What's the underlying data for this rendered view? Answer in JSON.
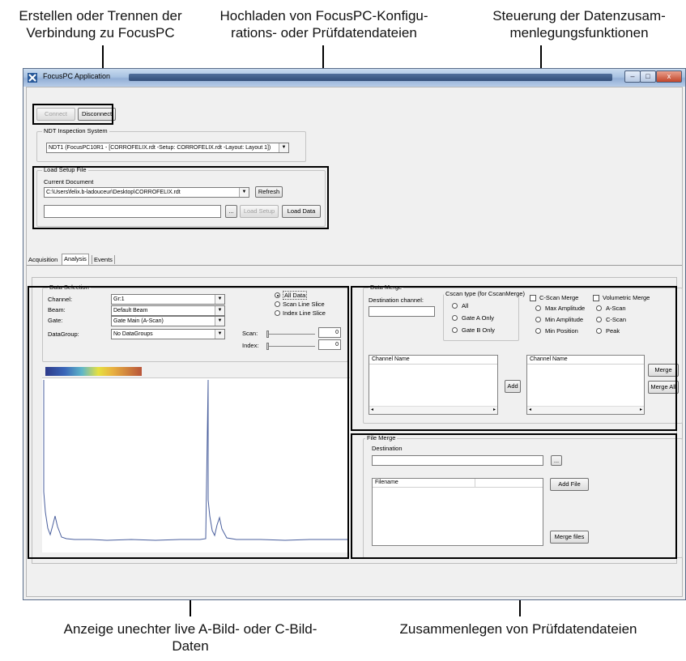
{
  "callouts": {
    "connect": "Erstellen oder Trennen der\nVerbindung zu FocusPC",
    "upload": "Hochladen von FocusPC-Konfigu-\nrations- oder Prüfdatendateien",
    "merge_control": "Steuerung der Datenzusam-\nmenlegungsfunktionen",
    "display": "Anzeige unechter live A-Bild- oder C-Bild-\nDaten",
    "file_merge": "Zusammenlegen von Prüfdatendateien"
  },
  "window": {
    "title": "FocusPC Application",
    "minimize": "–",
    "maximize": "□",
    "close": "x"
  },
  "connection": {
    "connect_label": "Connect",
    "disconnect_label": "Disconnect"
  },
  "ndt": {
    "group_label": "NDT Inspection System",
    "selected": "NDT1 (FocusPC10R1 - [CORROFELIX.rdt -Setup: CORROFELIX.rdt -Layout: Layout 1])"
  },
  "setup": {
    "group_label": "Load Setup File",
    "current_document_label": "Current Document",
    "current_document": "C:\\Users\\felix.b-ladouceur\\Desktop\\CORROFELIX.rdt",
    "refresh_label": "Refresh",
    "path_value": "",
    "browse_label": "...",
    "load_setup_label": "Load Setup",
    "load_data_label": "Load Data"
  },
  "tabs": [
    "Acquisition",
    "Analysis",
    "Events"
  ],
  "active_tab": "Analysis",
  "data_selection": {
    "group_label": "Data Selection",
    "channel_label": "Channel:",
    "channel_value": "Gr:1",
    "beam_label": "Beam:",
    "beam_value": "Default Beam",
    "gate_label": "Gate:",
    "gate_value": "Gate Main (A-Scan)",
    "datagroup_label": "DataGroup:",
    "datagroup_value": "No DataGroups",
    "radio_all": "All Data",
    "radio_scan": "Scan Line Slice",
    "radio_index": "Index Line Slice",
    "selected_radio": "All Data",
    "scan_label": "Scan:",
    "scan_value": "0",
    "index_label": "Index:",
    "index_value": "0"
  },
  "data_merge": {
    "group_label": "Data Merge",
    "destination_label": "Destination channel:",
    "destination_value": "",
    "cscan_group_label": "Cscan type (for CscanMerge)",
    "cscan_options": [
      "All",
      "Gate A Only",
      "Gate B Only"
    ],
    "cscan_merge_label": "C-Scan Merge",
    "cscan_merge_options": [
      "Max Amplitude",
      "Min Amplitude",
      "Min Position"
    ],
    "volumetric_label": "Volumetric Merge",
    "volumetric_options": [
      "A-Scan",
      "C-Scan",
      "Peak"
    ],
    "channel_name_header": "Channel Name",
    "add_label": "Add",
    "merge_label": "Merge",
    "merge_all_label": "Merge All"
  },
  "file_merge": {
    "group_label": "File Merge",
    "destination_label": "Destination",
    "destination_value": "",
    "browse_label": "...",
    "filename_header": "Filename",
    "add_file_label": "Add File",
    "merge_files_label": "Merge files"
  },
  "colors": {
    "title_bar": "#a8c2e2",
    "window_bg": "#f0f0f0",
    "callout_border": "#000000",
    "signal": "#4a5f9d"
  }
}
